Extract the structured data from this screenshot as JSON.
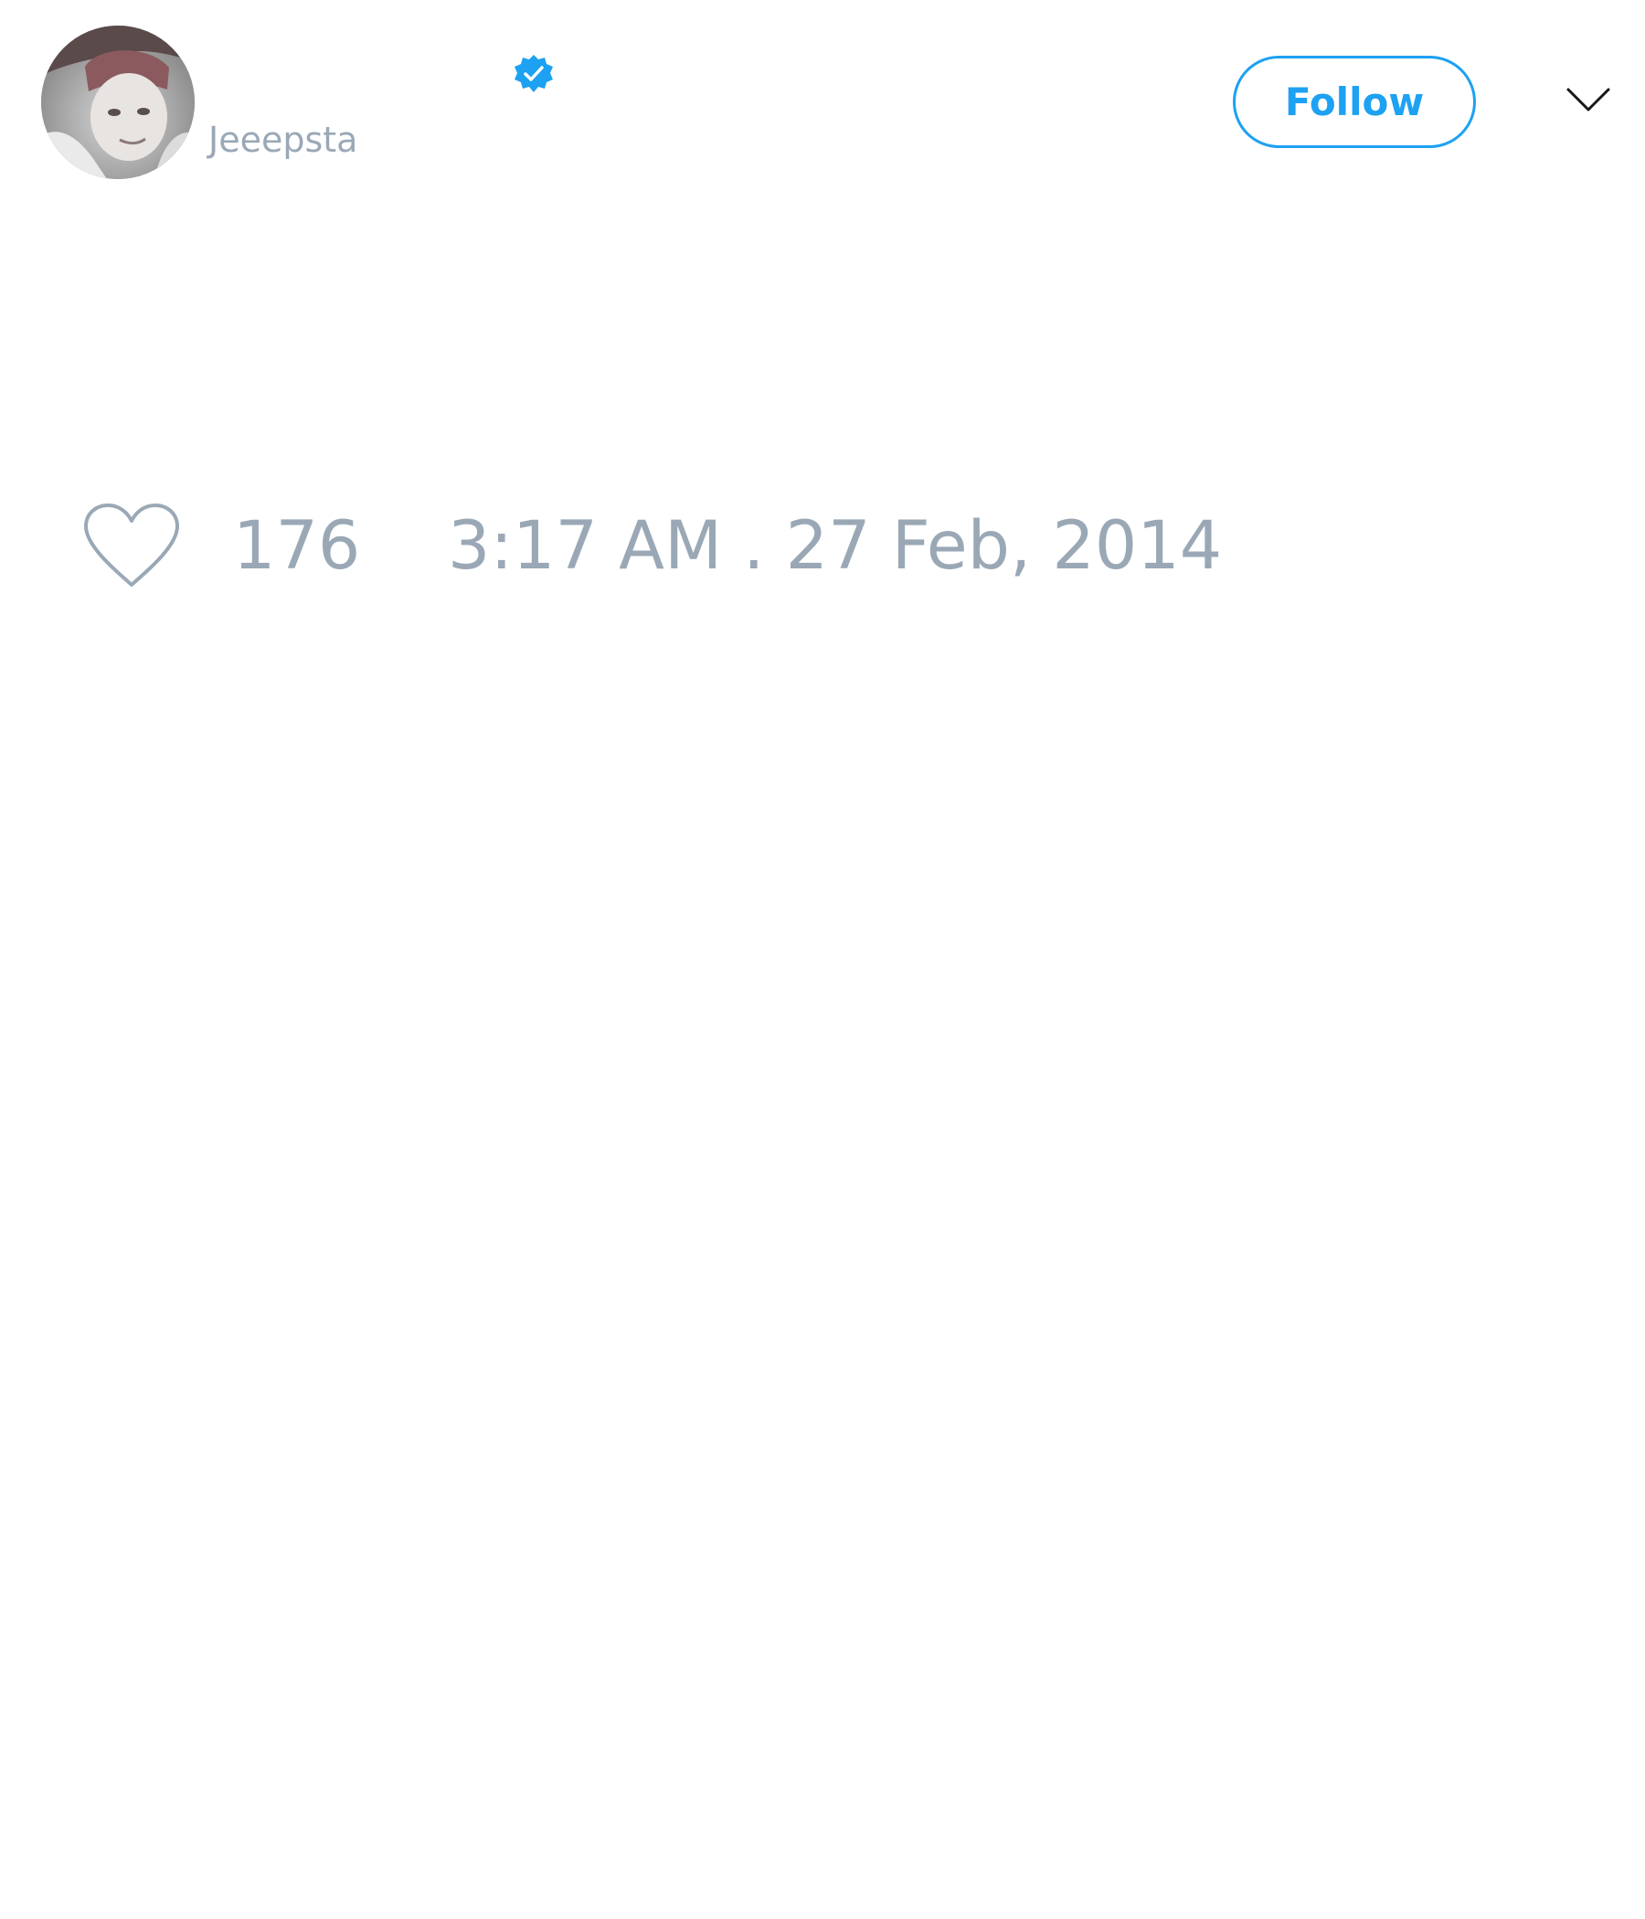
{
  "tweet": {
    "author": {
      "handle": "Jeeepsta",
      "verified": true,
      "avatar": "profile-photo"
    },
    "header": {
      "follow_label": "Follow",
      "menu_icon": "chevron-down-icon"
    },
    "stats": {
      "like_icon": "heart-outline-icon",
      "like_count": "176"
    },
    "timestamp": "3:17 AM . 27 Feb, 2014"
  },
  "colors": {
    "accent": "#1da1f2",
    "muted_text": "#9aa8b6",
    "background": "#ffffff"
  }
}
